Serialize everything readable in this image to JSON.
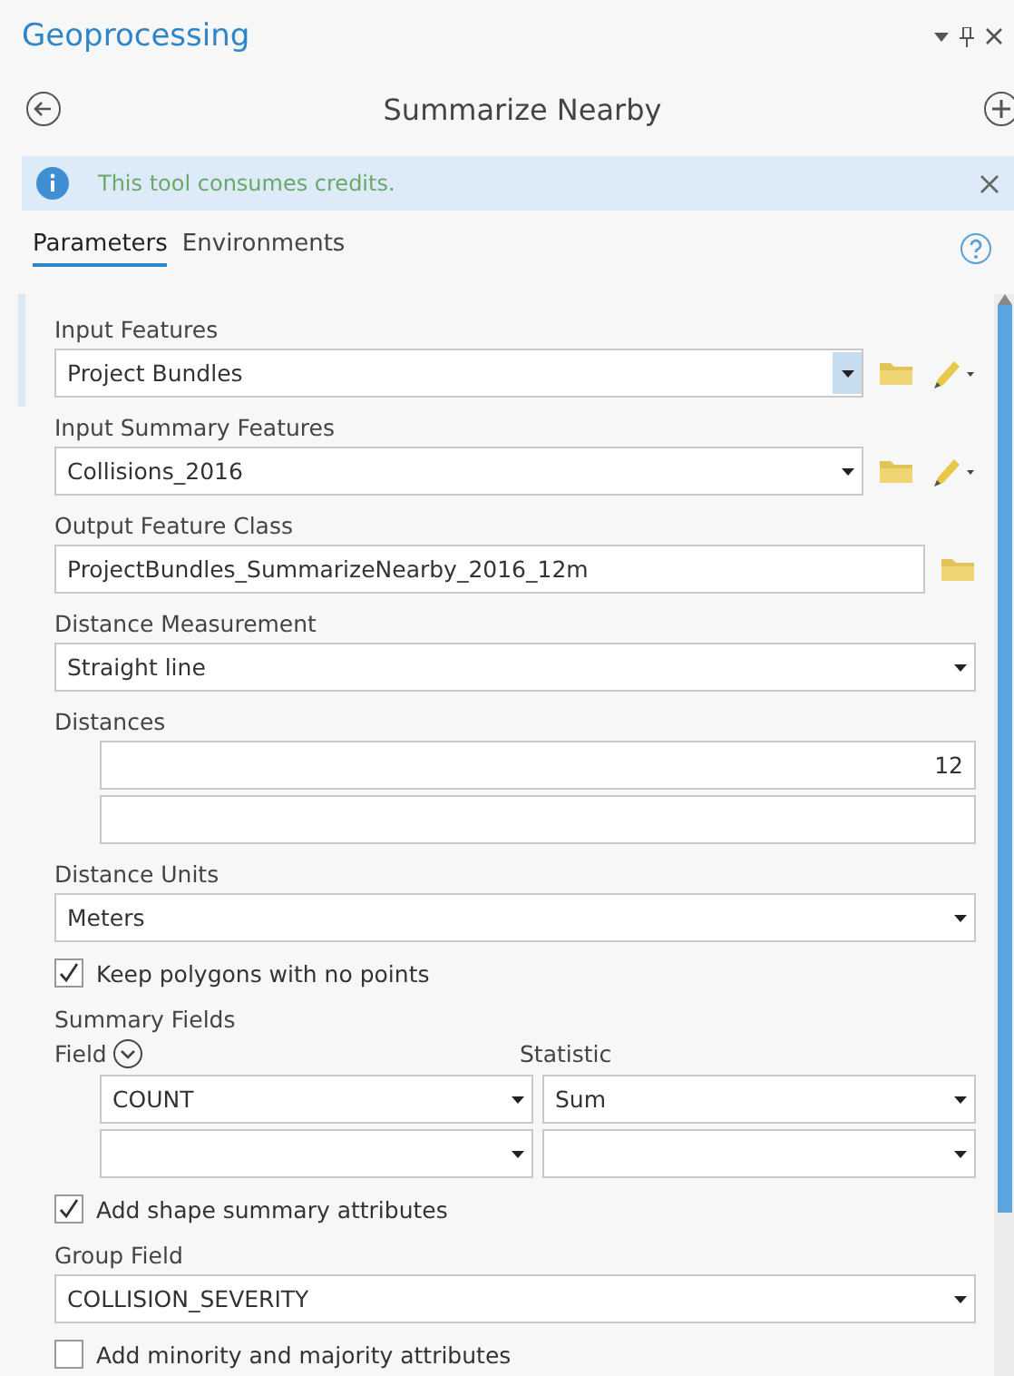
{
  "panel": {
    "title": "Geoprocessing"
  },
  "tool": {
    "title": "Summarize Nearby"
  },
  "notice": {
    "text": "This tool consumes credits."
  },
  "tabs": [
    {
      "label": "Parameters",
      "selected": true
    },
    {
      "label": "Environments",
      "selected": false
    }
  ],
  "parameters": [
    {
      "kind": "combo",
      "label": "Input Features",
      "value": "Project Bundles",
      "focused": true
    },
    {
      "kind": "combo",
      "label": "Input Summary Features",
      "value": "Collisions_2016",
      "focused": false
    },
    {
      "kind": "output",
      "label": "Output Feature Class",
      "value": "ProjectBundles_SummarizeNearby_2016_12m"
    },
    {
      "kind": "dropdown",
      "label": "Distance Measurement",
      "value": "Straight line"
    },
    {
      "kind": "list",
      "label": "Distances",
      "values": [
        "12"
      ]
    },
    {
      "kind": "dropdown",
      "label": "Distance Units",
      "value": "Meters"
    },
    {
      "kind": "checkbox",
      "label": "Keep polygons with no points",
      "checked": true
    },
    {
      "kind": "table",
      "label": "Summary Fields",
      "columns": [
        "Field",
        "Statistic"
      ],
      "rows": [
        [
          "COUNT",
          "Sum"
        ]
      ]
    },
    {
      "kind": "checkbox",
      "label": "Add shape summary attributes",
      "checked": true
    },
    {
      "kind": "dropdown",
      "label": "Group Field",
      "value": "COLLISION_SEVERITY"
    },
    {
      "kind": "checkbox",
      "label": "Add minority and majority attributes",
      "checked": false
    }
  ]
}
